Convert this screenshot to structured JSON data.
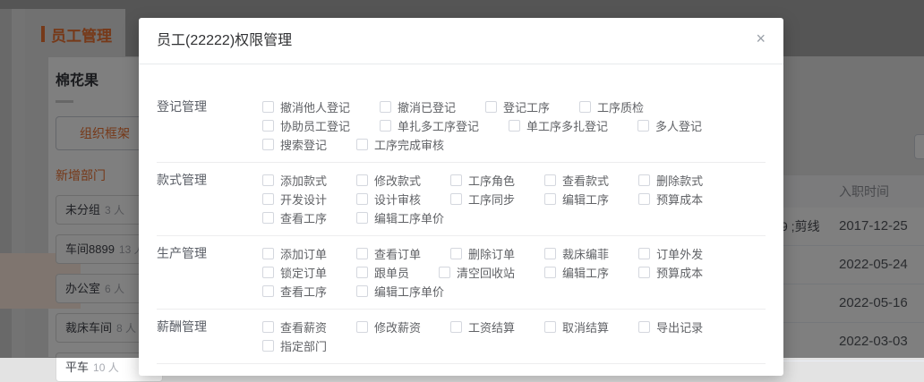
{
  "colors": {
    "accent": "#ed7332"
  },
  "background": {
    "page_title": "员工管理",
    "panel": {
      "title": "棉花果",
      "org_button": "组织框架",
      "add_dept_link": "新增部门",
      "departments": [
        {
          "name": "未分组",
          "count": "3 人"
        },
        {
          "name": "车间8899",
          "count": "13 人"
        },
        {
          "name": "办公室",
          "count": "6 人"
        },
        {
          "name": "裁床车间",
          "count": "8 人"
        },
        {
          "name": "平车",
          "count": "10 人"
        }
      ]
    },
    "table": {
      "hire_date_header": "入职时间",
      "row_fragment": "9 ;剪线",
      "hire_dates": [
        "2017-12-25",
        "2022-05-24",
        "2022-05-16",
        "2022-03-03"
      ]
    }
  },
  "modal": {
    "title": "员工(22222)权限管理",
    "close_icon": "×",
    "all_checkboxes_checked": false,
    "sections": [
      {
        "label": "登记管理",
        "rows": [
          [
            "撤消他人登记",
            "撤消已登记",
            "登记工序",
            "工序质检"
          ],
          [
            "协助员工登记",
            "单扎多工序登记",
            "单工序多扎登记",
            "多人登记"
          ],
          [
            "搜索登记",
            "工序完成审核"
          ]
        ]
      },
      {
        "label": "款式管理",
        "rows": [
          [
            "添加款式",
            "修改款式",
            "工序角色",
            "查看款式",
            "删除款式"
          ],
          [
            "开发设计",
            "设计审核",
            "工序同步",
            "编辑工序",
            "预算成本"
          ],
          [
            "查看工序",
            "编辑工序单价"
          ]
        ]
      },
      {
        "label": "生产管理",
        "rows": [
          [
            "添加订单",
            "查看订单",
            "删除订单",
            "裁床编菲",
            "订单外发"
          ],
          [
            "锁定订单",
            "跟单员",
            "清空回收站",
            "编辑工序",
            "预算成本"
          ],
          [
            "查看工序",
            "编辑工序单价"
          ]
        ]
      },
      {
        "label": "薪酬管理",
        "rows": [
          [
            "查看薪资",
            "修改薪资",
            "工资结算",
            "取消结算",
            "导出记录"
          ],
          [
            "指定部门"
          ]
        ]
      }
    ]
  }
}
